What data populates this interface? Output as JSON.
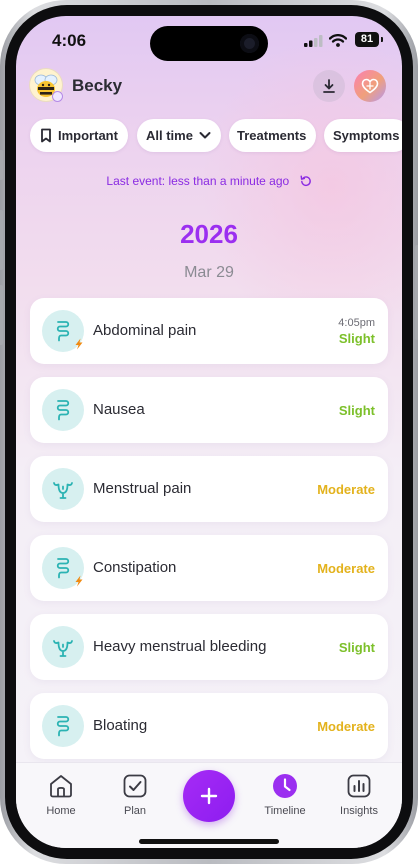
{
  "status_bar": {
    "time": "4:06",
    "battery": "81"
  },
  "header": {
    "username": "Becky",
    "avatar_icon": "bee-avatar-icon",
    "download_icon": "download-icon",
    "profile_icon": "heart-profile-icon"
  },
  "filters": [
    {
      "label": "Important",
      "icon": "bookmark-icon"
    },
    {
      "label": "All time",
      "icon": "chevron-down-icon"
    },
    {
      "label": "Treatments"
    },
    {
      "label": "Symptoms"
    }
  ],
  "last_event": {
    "text": "Last event: less than a minute ago",
    "icon": "refresh-icon"
  },
  "timeline": {
    "year": "2026",
    "date": "Mar 29",
    "events": [
      {
        "name": "Abdominal pain",
        "time": "4:05pm",
        "severity": "Slight",
        "icon": "intestine-icon",
        "flagged": true
      },
      {
        "name": "Nausea",
        "severity": "Slight",
        "icon": "intestine-icon",
        "flagged": false
      },
      {
        "name": "Menstrual pain",
        "severity": "Moderate",
        "icon": "uterus-icon",
        "flagged": false
      },
      {
        "name": "Constipation",
        "severity": "Moderate",
        "icon": "intestine-icon",
        "flagged": true
      },
      {
        "name": "Heavy menstrual bleeding",
        "severity": "Slight",
        "icon": "uterus-icon",
        "flagged": false
      },
      {
        "name": "Bloating",
        "severity": "Moderate",
        "icon": "intestine-icon",
        "flagged": false
      }
    ]
  },
  "colors": {
    "accent": "#9b2ff0",
    "slight": "#7cc02a",
    "moderate": "#e3b21c",
    "icon_teal": "#2bb3b3"
  },
  "tab_bar": {
    "tabs": [
      {
        "label": "Home",
        "icon": "home-icon",
        "active": false
      },
      {
        "label": "Plan",
        "icon": "checkbox-icon",
        "active": false
      },
      {
        "label": "Timeline",
        "icon": "clock-icon",
        "active": true
      },
      {
        "label": "Insights",
        "icon": "chart-icon",
        "active": false
      }
    ],
    "fab_icon": "plus-icon"
  }
}
